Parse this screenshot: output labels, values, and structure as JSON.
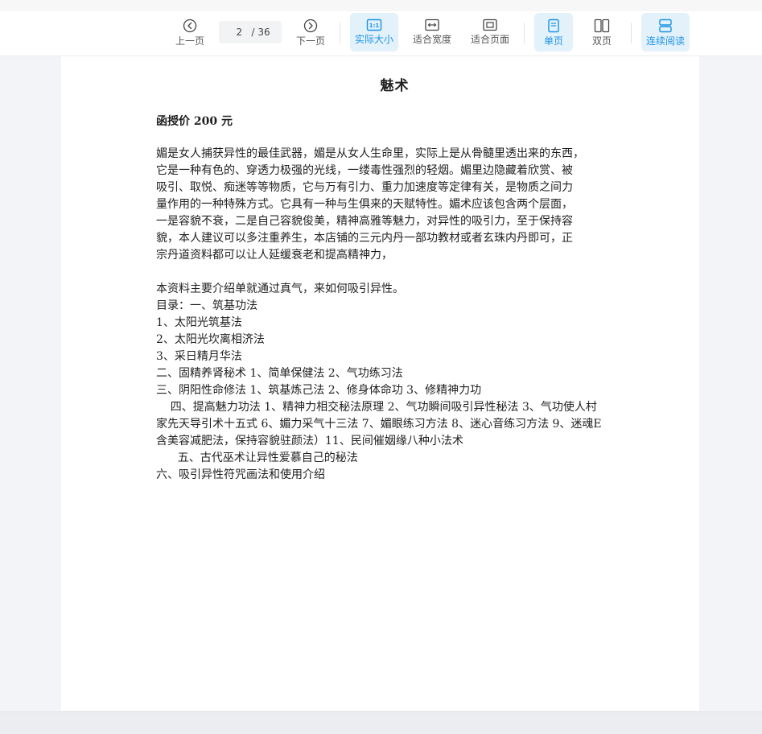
{
  "toolbar": {
    "prev_label": "上一页",
    "current_page": "2",
    "page_separator": "/",
    "total_pages": "36",
    "next_label": "下一页",
    "actual_size_label": "实际大小",
    "fit_width_label": "适合宽度",
    "fit_page_label": "适合页面",
    "single_page_label": "单页",
    "double_page_label": "双页",
    "continuous_label": "连续阅读",
    "active_zoom": "实际大小",
    "active_layout": "单页",
    "active_continuous": "连续阅读",
    "accent_color": "#1a93e6",
    "active_bg_color": "#e3f1fb"
  },
  "icons": {
    "prev": "chevron-left-circle-icon",
    "next": "chevron-right-circle-icon",
    "actual_size": "actual-size-icon",
    "fit_width": "fit-width-icon",
    "fit_page": "fit-page-icon",
    "single_page": "single-page-icon",
    "double_page": "double-page-icon",
    "continuous": "continuous-read-icon"
  },
  "document": {
    "title": "魅术",
    "price": "函授价 200 元",
    "lines": [
      "媚是女人捕获异性的最佳武器，媚是从女人生命里，实际上是从骨髓里透出来的东西，",
      "它是一种有色的、穿透力极强的光线，一缕毒性强烈的轻烟。媚里边隐藏着欣赏、被",
      "吸引、取悦、痴迷等等物质，它与万有引力、重力加速度等定律有关，是物质之间力",
      "量作用的一种特殊方式。它具有一种与生俱来的天赋特性。媚术应该包含两个层面，",
      "一是容貌不衰，二是自己容貌俊美，精神高雅等魅力，对异性的吸引力，至于保持容",
      "貌，本人建议可以多注重养生，本店铺的三元内丹一部功教材或者玄珠内丹即可，正",
      "宗丹道资料都可以让人延缓衰老和提高精神力，",
      "",
      "本资料主要介绍单就通过真气，来如何吸引异性。",
      "目录：一、筑基功法",
      "1、太阳光筑基法",
      "2、太阳光坎离相济法",
      "3、采日精月华法",
      "二、固精养肾秘术 1、简单保健法 2、气功练习法",
      "三、阴阳性命修法 1、筑基炼己法 2、修身体命功 3、修精神力功",
      "    四、提高魅力功法 1、精神力相交秘法原理 2、气功瞬间吸引异性秘法 3、气功使人村",
      "家先天导引术十五式 6、媚力采气十三法 7、媚眼练习方法 8、迷心音练习方法 9、迷魂E",
      "含美容减肥法，保持容貌驻颜法）11、民间催姻缘八种小法术",
      "      五、古代巫术让异性爱慕自己的秘法",
      "六、吸引异性符咒画法和使用介绍"
    ]
  }
}
